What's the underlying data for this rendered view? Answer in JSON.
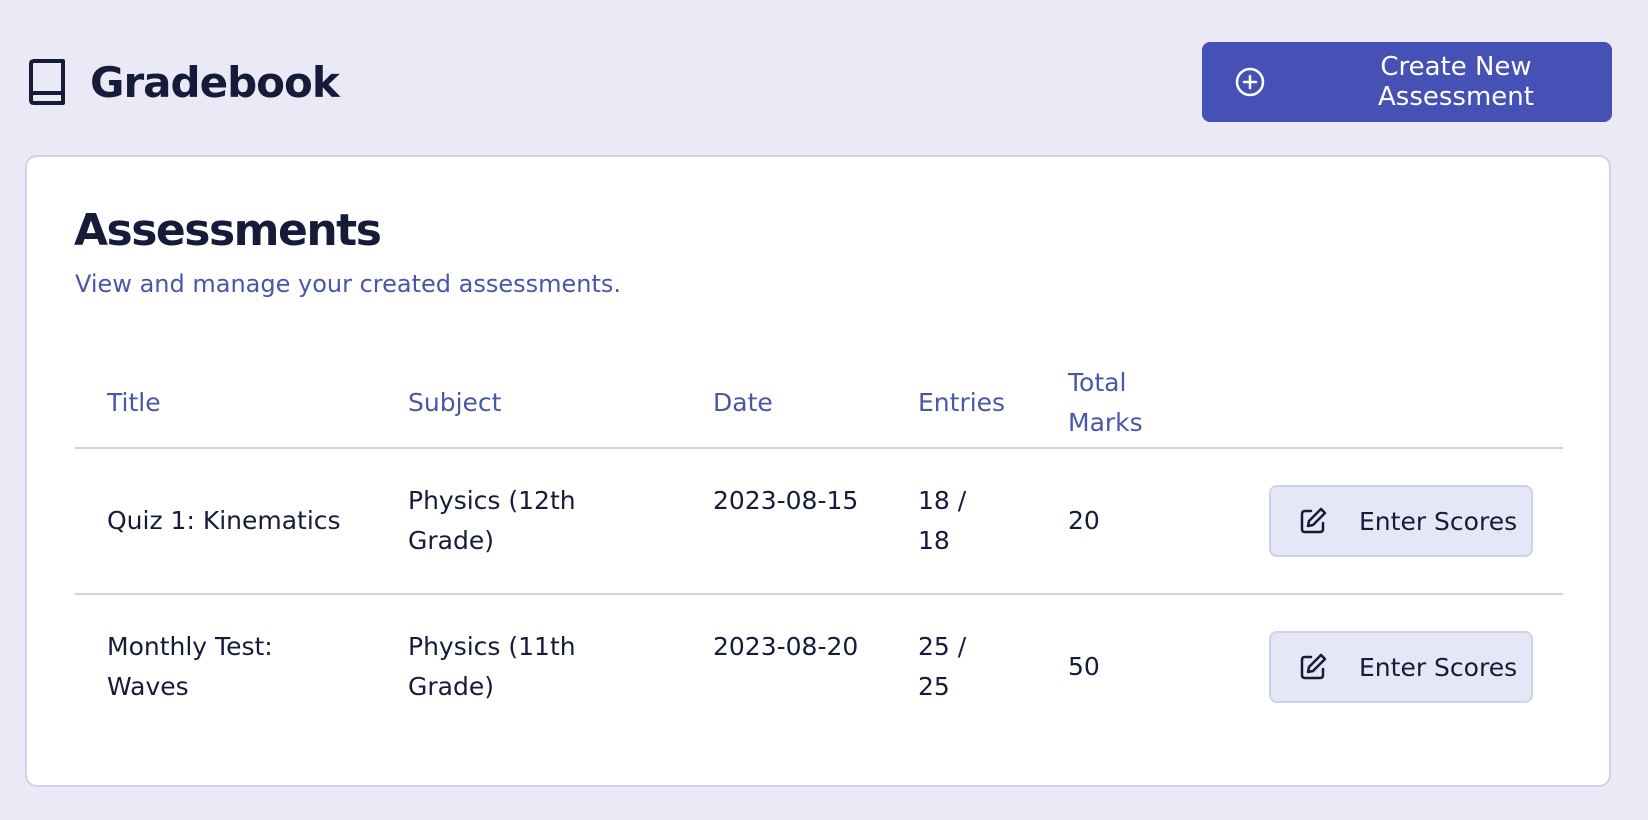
{
  "header": {
    "title": "Gradebook",
    "logo_icon": "book-icon",
    "create_button": {
      "label": "Create New Assessment",
      "icon": "plus-circle-icon"
    }
  },
  "card": {
    "title": "Assessments",
    "subtitle": "View and manage your created assessments."
  },
  "table": {
    "columns": [
      "Title",
      "Subject",
      "Date",
      "Entries",
      "Total Marks"
    ],
    "rows": [
      {
        "title": "Quiz 1: Kinematics",
        "subject": "Physics (12th Grade)",
        "date": "2023-08-15",
        "entries": "18 / 18",
        "total": "20",
        "action": "Enter Scores"
      },
      {
        "title": "Monthly Test: Waves",
        "subject": "Physics (11th Grade)",
        "date": "2023-08-20",
        "entries": "25 / 25",
        "total": "50",
        "action": "Enter Scores"
      }
    ]
  },
  "colors": {
    "background": "#eae9f5",
    "primary": "#4551b4",
    "muted_text": "#4a56a8",
    "border": "#cfd1ec"
  }
}
